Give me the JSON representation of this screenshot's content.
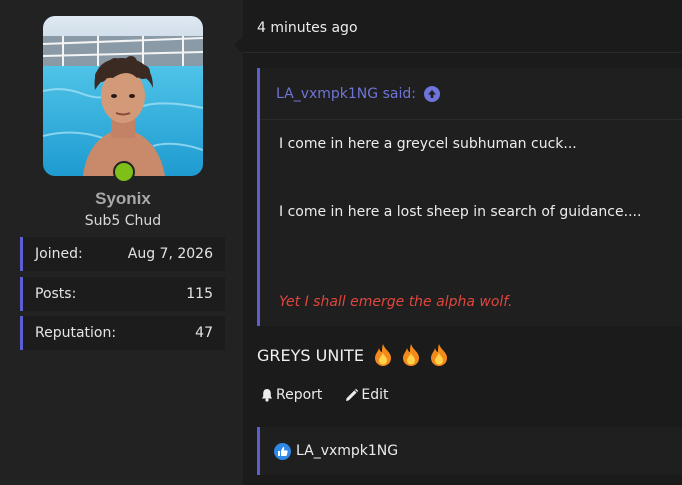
{
  "user": {
    "username": "Syonix",
    "title": "Sub5 Chud",
    "online": true,
    "stats": [
      {
        "label": "Joined:",
        "value": "Aug 7, 2026"
      },
      {
        "label": "Posts:",
        "value": "115"
      },
      {
        "label": "Reputation:",
        "value": "47"
      }
    ]
  },
  "post": {
    "time": "4 minutes ago",
    "quote": {
      "author": "LA_vxmpk1NG said:",
      "lines": [
        "I come in here a greycel subhuman cuck...",
        "I come in here a lost sheep in search of guidance...."
      ],
      "red_line": "Yet I shall emerge the alpha wolf."
    },
    "message": "GREYS UNITE",
    "emoji": [
      "fire-icon",
      "fire-icon",
      "fire-icon"
    ],
    "actions": {
      "report": "Report",
      "edit": "Edit"
    },
    "reaction_user": "LA_vxmpk1NG"
  },
  "colors": {
    "accent": "#5c5fd0",
    "quote_author": "#6f74d8",
    "red_text": "#e0463c",
    "online": "#7fbf1a",
    "like": "#2f87e6"
  }
}
